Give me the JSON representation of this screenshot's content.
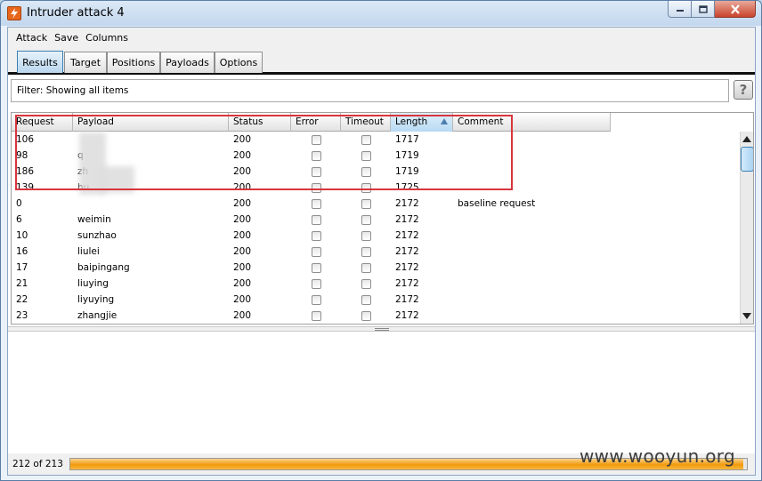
{
  "window": {
    "title": "Intruder attack 4"
  },
  "menu": [
    "Attack",
    "Save",
    "Columns"
  ],
  "tabs": [
    {
      "label": "Results",
      "active": true
    },
    {
      "label": "Target",
      "active": false
    },
    {
      "label": "Positions",
      "active": false
    },
    {
      "label": "Payloads",
      "active": false
    },
    {
      "label": "Options",
      "active": false
    }
  ],
  "filter": {
    "text": "Filter:  Showing all items",
    "help": "?"
  },
  "table": {
    "columns": [
      "Request",
      "Payload",
      "Status",
      "Error",
      "Timeout",
      "Length",
      "Comment"
    ],
    "sorted_column": "Length",
    "rows": [
      {
        "request": "106",
        "payload": "",
        "status": "200",
        "error": false,
        "timeout": false,
        "length": "1717",
        "comment": ""
      },
      {
        "request": "98",
        "payload": "q",
        "status": "200",
        "error": false,
        "timeout": false,
        "length": "1719",
        "comment": ""
      },
      {
        "request": "186",
        "payload": "zh",
        "status": "200",
        "error": false,
        "timeout": false,
        "length": "1719",
        "comment": ""
      },
      {
        "request": "139",
        "payload": "hu",
        "status": "200",
        "error": false,
        "timeout": false,
        "length": "1725",
        "comment": ""
      },
      {
        "request": "0",
        "payload": "",
        "status": "200",
        "error": false,
        "timeout": false,
        "length": "2172",
        "comment": "baseline request"
      },
      {
        "request": "6",
        "payload": "weimin",
        "status": "200",
        "error": false,
        "timeout": false,
        "length": "2172",
        "comment": ""
      },
      {
        "request": "10",
        "payload": "sunzhao",
        "status": "200",
        "error": false,
        "timeout": false,
        "length": "2172",
        "comment": ""
      },
      {
        "request": "16",
        "payload": "liulei",
        "status": "200",
        "error": false,
        "timeout": false,
        "length": "2172",
        "comment": ""
      },
      {
        "request": "17",
        "payload": "baipingang",
        "status": "200",
        "error": false,
        "timeout": false,
        "length": "2172",
        "comment": ""
      },
      {
        "request": "21",
        "payload": "liuying",
        "status": "200",
        "error": false,
        "timeout": false,
        "length": "2172",
        "comment": ""
      },
      {
        "request": "22",
        "payload": "liyuying",
        "status": "200",
        "error": false,
        "timeout": false,
        "length": "2172",
        "comment": ""
      },
      {
        "request": "23",
        "payload": "zhangjie",
        "status": "200",
        "error": false,
        "timeout": false,
        "length": "2172",
        "comment": ""
      }
    ]
  },
  "progress": {
    "label": "212 of 213",
    "fraction": 0.995
  },
  "watermark": "www.wooyun.org",
  "colors": {
    "highlight": "#d8353d",
    "progress": "#f29a0e",
    "active_tab": "#b9d6ee"
  },
  "icons": {
    "app": "burp-lightning-icon",
    "minimize": "minimize-icon",
    "maximize": "maximize-icon",
    "close": "close-icon",
    "sort": "sort-ascending-icon"
  }
}
